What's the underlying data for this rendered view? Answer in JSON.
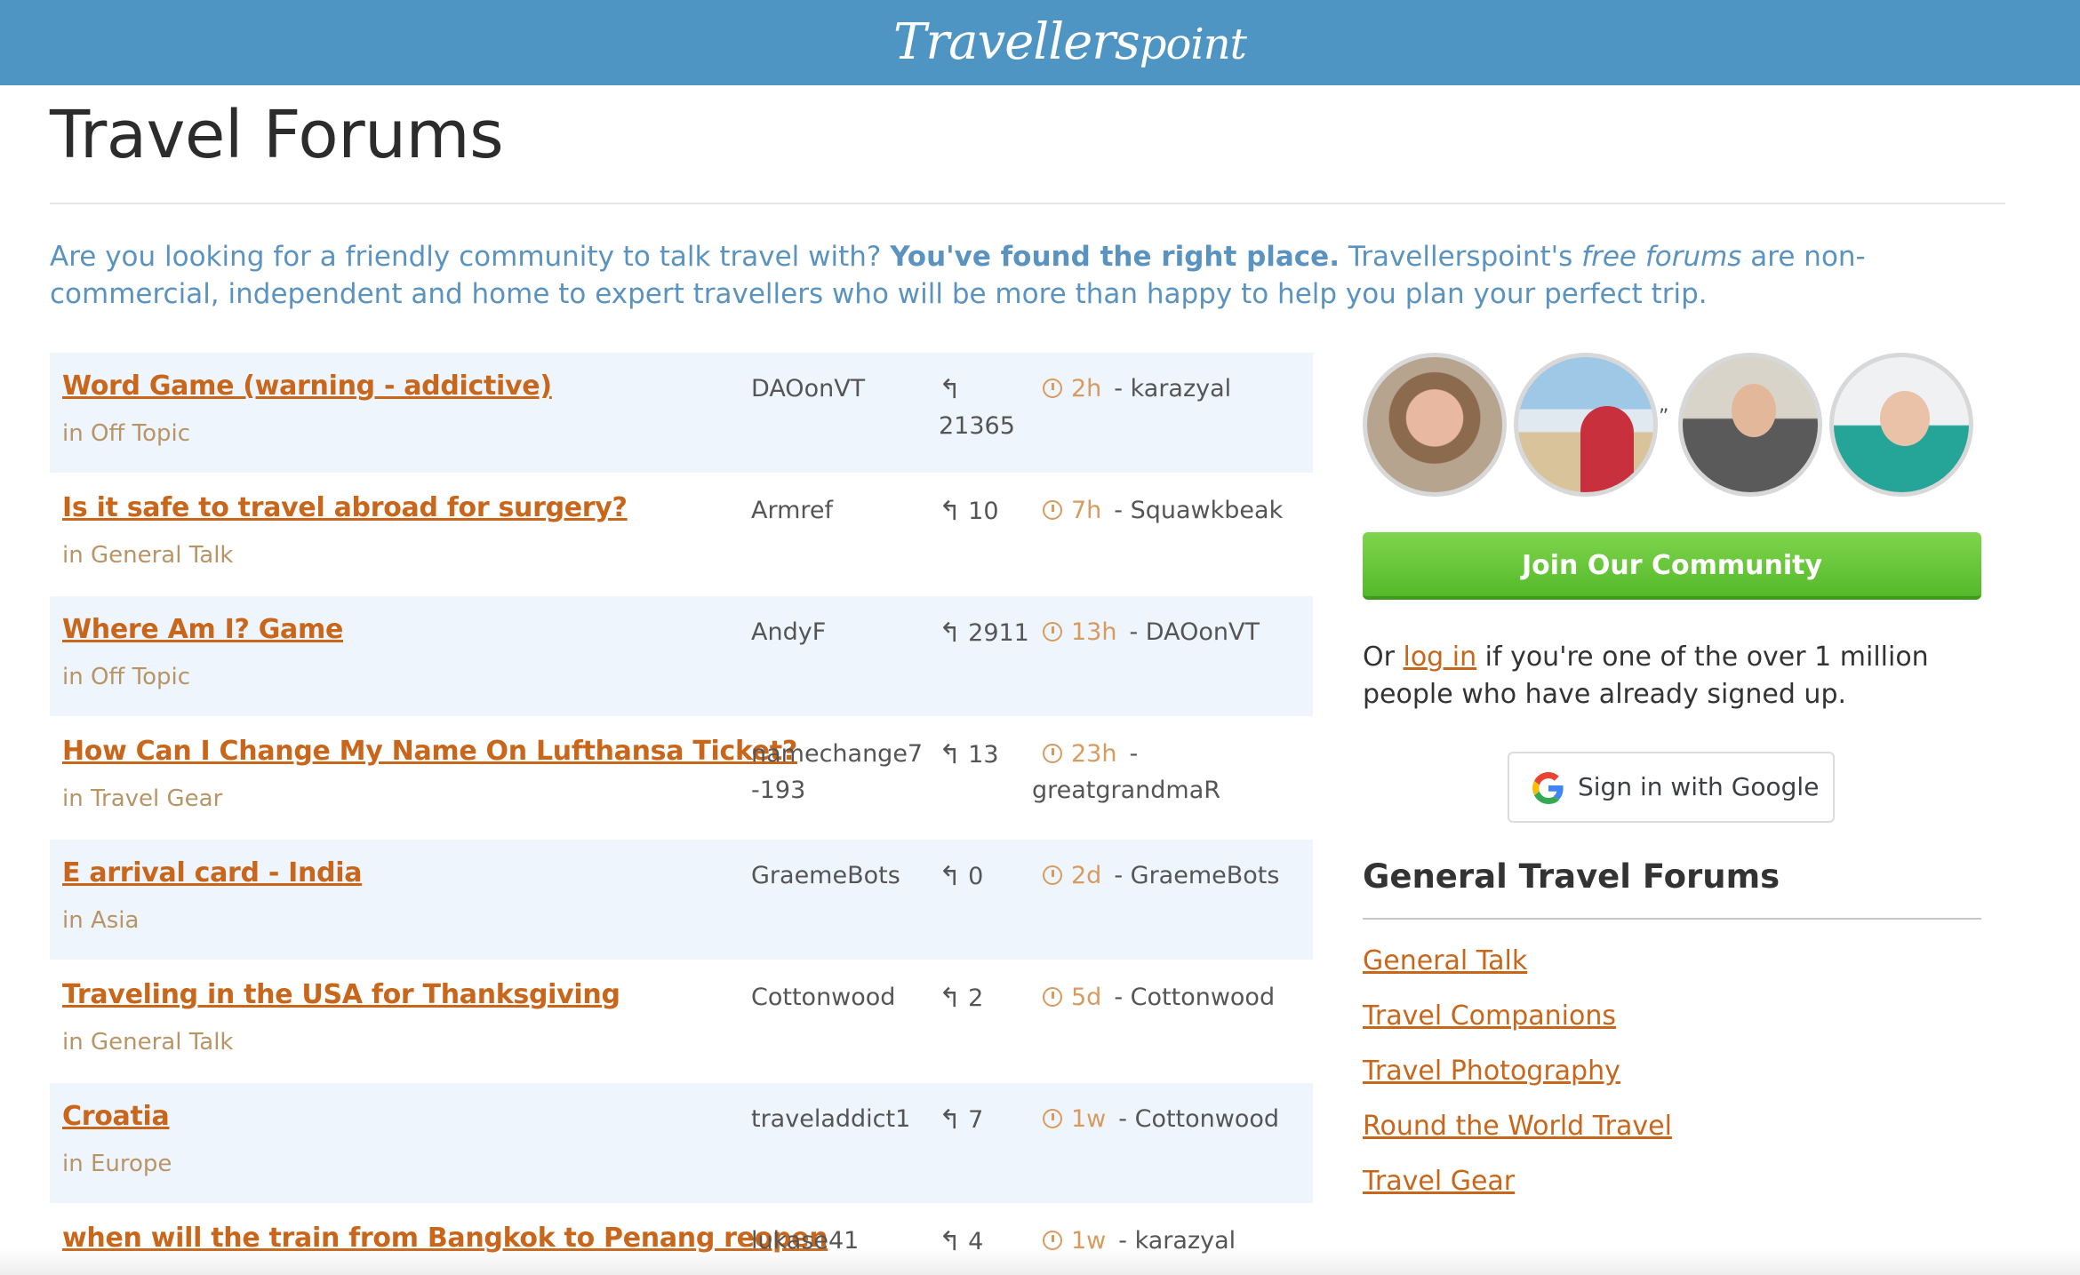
{
  "header": {
    "logo_text": "Travellers",
    "logo_text_suffix": "point"
  },
  "page": {
    "title": "Travel Forums",
    "intro_part1": "Are you looking for a friendly community to talk travel with? ",
    "intro_bold": "You've found the right place.",
    "intro_part2": " Travellerspoint's ",
    "intro_italic": "free forums",
    "intro_part3": " are non-commercial, independent and home to expert travellers who will be more than happy to help you plan your perfect trip."
  },
  "topics": [
    {
      "title": "Word Game (warning - addictive)",
      "category": "in Off Topic",
      "author": "DAOonVT",
      "replies": "21365",
      "age": "2h",
      "last_poster": "- karazyal"
    },
    {
      "title": "Is it safe to travel abroad for surgery?",
      "category": "in General Talk",
      "author": "Armref",
      "replies": "10",
      "age": "7h",
      "last_poster": "- Squawkbeak"
    },
    {
      "title": "Where Am I? Game",
      "category": "in Off Topic",
      "author": "AndyF",
      "replies": "2911",
      "age": "13h",
      "last_poster": "- DAOonVT"
    },
    {
      "title": "How Can I Change My Name On Lufthansa Ticket?",
      "category": "in Travel Gear",
      "author": "namechange7-193",
      "replies": "13",
      "age": "23h",
      "last_poster": "- greatgrandmaR"
    },
    {
      "title": "E arrival card - India",
      "category": "in Asia",
      "author": "GraemeBots",
      "replies": "0",
      "age": "2d",
      "last_poster": "- GraemeBots"
    },
    {
      "title": "Traveling in the USA for Thanksgiving",
      "category": "in General Talk",
      "author": "Cottonwood",
      "replies": "2",
      "age": "5d",
      "last_poster": "- Cottonwood"
    },
    {
      "title": "Croatia",
      "category": "in Europe",
      "author": "traveladdict1",
      "replies": "7",
      "age": "1w",
      "last_poster": "- Cottonwood"
    },
    {
      "title": "when will the train from Bangkok to Penang reopen",
      "category": "",
      "author": "lukase41",
      "replies": "4",
      "age": "1w",
      "last_poster": "- karazyal"
    }
  ],
  "sidebar": {
    "avatar_quote": "”",
    "join_label": "Join Our Community",
    "login_prefix": "Or ",
    "login_link": "log in",
    "login_suffix": " if you're one of the over 1 million people who have already signed up.",
    "google_label": "Sign in with Google",
    "forums_heading": "General Travel Forums",
    "forums": [
      {
        "label": "General Talk"
      },
      {
        "label": "Travel Companions"
      },
      {
        "label": "Travel Photography"
      },
      {
        "label": "Round the World Travel"
      },
      {
        "label": "Travel Gear"
      }
    ]
  },
  "colors": {
    "header_bg": "#4f95c4",
    "link": "#c8661b",
    "intro_text": "#5b93c0",
    "row_alt_bg": "#eef5fc",
    "join_green": "#55b92a"
  },
  "icons": {
    "reply": "reply-arrow-icon",
    "time": "clock-icon",
    "google": "google-g-icon"
  }
}
